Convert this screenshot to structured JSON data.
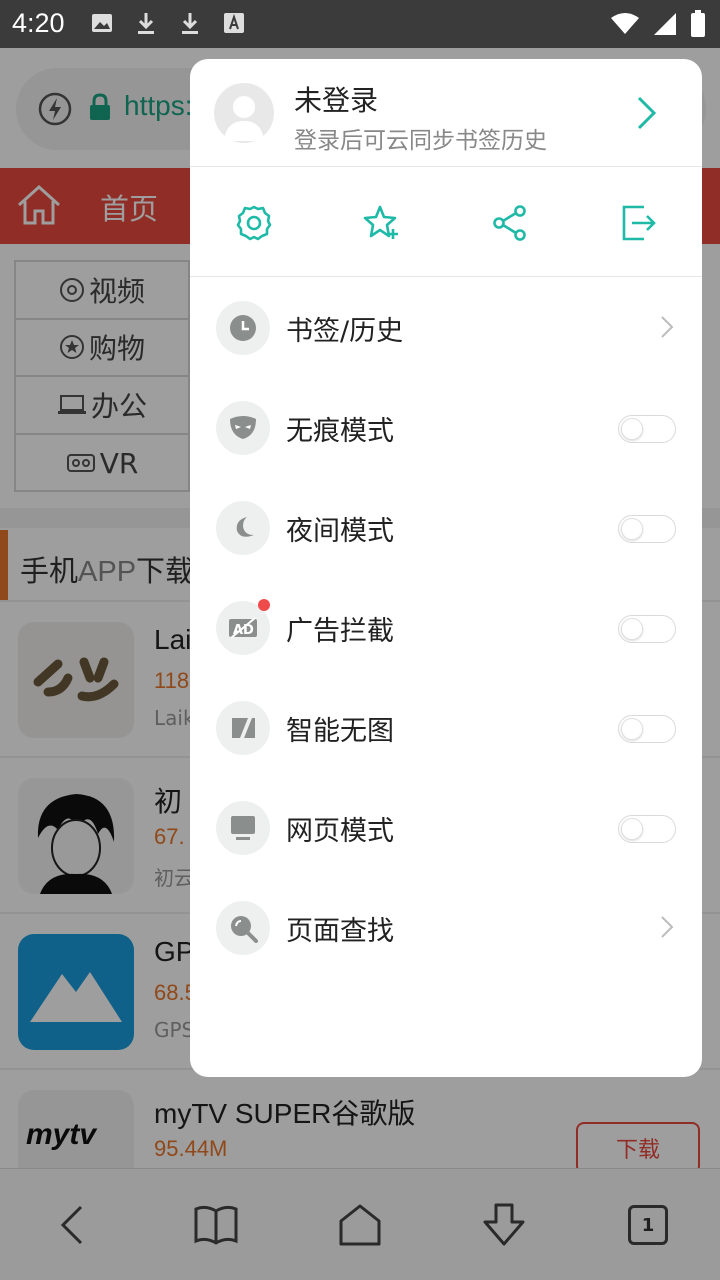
{
  "status_bar": {
    "time": "4:20"
  },
  "browser": {
    "url_text": "https:",
    "nav_home_label": "首页",
    "categories": [
      "视频",
      "购物",
      "办公",
      "VR"
    ],
    "section_title_prefix": "手机",
    "section_title_app": "APP",
    "section_title_suffix": "下载",
    "apps": [
      {
        "name": "Lai",
        "size": "118",
        "desc": "Laik"
      },
      {
        "name": "初",
        "size": "67.",
        "desc": "初云"
      },
      {
        "name": "GP",
        "size": "68.5",
        "desc": "GPS"
      },
      {
        "name": "myTV SUPER谷歌版",
        "size": "95.44M",
        "desc": "",
        "download_label": "下载",
        "thumb_text": "mytv"
      }
    ],
    "tab_count": "1"
  },
  "menu": {
    "header": {
      "title": "未登录",
      "subtitle": "登录后可云同步书签历史"
    },
    "quick_actions": [
      {
        "icon": "gear-icon"
      },
      {
        "icon": "star-plus-icon"
      },
      {
        "icon": "share-icon"
      },
      {
        "icon": "exit-icon"
      }
    ],
    "items": [
      {
        "label": "书签/历史",
        "icon": "clock-icon",
        "control": "chevron"
      },
      {
        "label": "无痕模式",
        "icon": "mask-icon",
        "control": "toggle",
        "on": false
      },
      {
        "label": "夜间模式",
        "icon": "moon-icon",
        "control": "toggle",
        "on": false
      },
      {
        "label": "广告拦截",
        "icon": "ad-block-icon",
        "control": "toggle",
        "on": false,
        "badge": true
      },
      {
        "label": "智能无图",
        "icon": "no-image-icon",
        "control": "toggle",
        "on": false
      },
      {
        "label": "网页模式",
        "icon": "desktop-icon",
        "control": "toggle",
        "on": false
      },
      {
        "label": "页面查找",
        "icon": "find-icon",
        "control": "chevron"
      }
    ]
  },
  "colors": {
    "accent": "#1fb9a8",
    "brand_red": "#e94a3e",
    "orange": "#e8762b"
  }
}
